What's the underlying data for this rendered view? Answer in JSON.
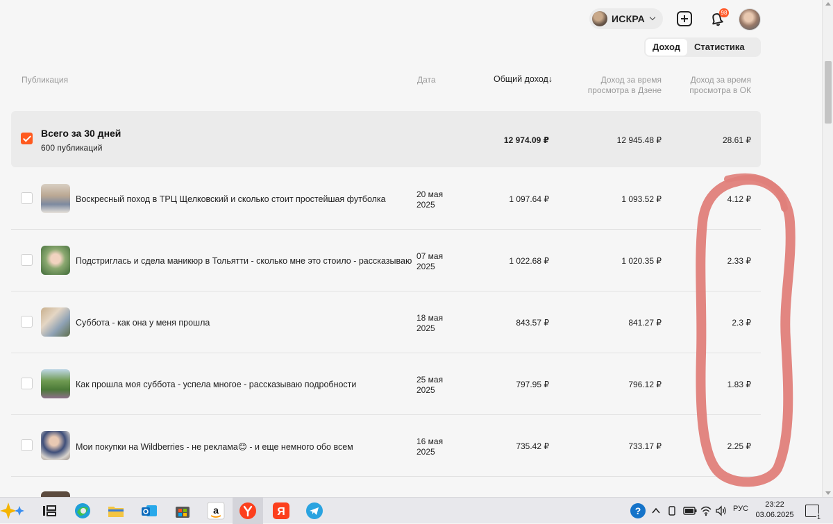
{
  "header": {
    "channel_name": "ИСКРА",
    "notifications_count": "98"
  },
  "tabs": [
    {
      "label": "Доход",
      "active": true
    },
    {
      "label": "Статистика",
      "active": false
    }
  ],
  "table": {
    "columns": {
      "publication": "Публикация",
      "date": "Дата",
      "total_income": "Общий доход",
      "sort_arrow": "↓",
      "dzen_income_line1": "Доход за время",
      "dzen_income_line2": "просмотра в Дзене",
      "ok_income_line1": "Доход за время",
      "ok_income_line2": "просмотра в ОК"
    },
    "total": {
      "title": "Всего за 30 дней",
      "subtitle": "600 публикаций",
      "total_income": "12 974.09 ₽",
      "dzen_income": "12 945.48 ₽",
      "ok_income": "28.61 ₽",
      "checked": true
    },
    "rows": [
      {
        "title": "Воскресный поход в ТРЦ Щелковский и сколько стоит простейшая футболка",
        "date_day": "20 мая",
        "date_year": "2025",
        "total_income": "1 097.64 ₽",
        "dzen_income": "1 093.52 ₽",
        "ok_income": "4.12 ₽"
      },
      {
        "title": "Подстриглась и сдела маникюр в Тольятти - сколько мне это стоило - рассказываю",
        "date_day": "07 мая",
        "date_year": "2025",
        "total_income": "1 022.68 ₽",
        "dzen_income": "1 020.35 ₽",
        "ok_income": "2.33 ₽"
      },
      {
        "title": "Суббота - как она у меня прошла",
        "date_day": "18 мая",
        "date_year": "2025",
        "total_income": "843.57 ₽",
        "dzen_income": "841.27 ₽",
        "ok_income": "2.3 ₽"
      },
      {
        "title": "Как прошла моя суббота - успела многое - рассказываю подробности",
        "date_day": "25 мая",
        "date_year": "2025",
        "total_income": "797.95 ₽",
        "dzen_income": "796.12 ₽",
        "ok_income": "1.83 ₽"
      },
      {
        "title": "Мои покупки на Wildberries - не реклама😊 - и еще немного обо всем",
        "date_day": "16 мая",
        "date_year": "2025",
        "total_income": "735.42 ₽",
        "dzen_income": "733.17 ₽",
        "ok_income": "2.25 ₽"
      }
    ]
  },
  "annotation": {
    "color": "#e0807a"
  },
  "taskbar": {
    "apps": [
      "copilot-icon",
      "task-view-icon",
      "edge-icon",
      "file-explorer-icon",
      "outlook-icon",
      "store-icon",
      "amazon-icon",
      "yandex-browser-icon",
      "yandex-icon",
      "telegram-icon"
    ],
    "language": "РУС",
    "time": "23:22",
    "date": "03.06.2025",
    "notification_count": "1",
    "help_glyph": "?"
  }
}
